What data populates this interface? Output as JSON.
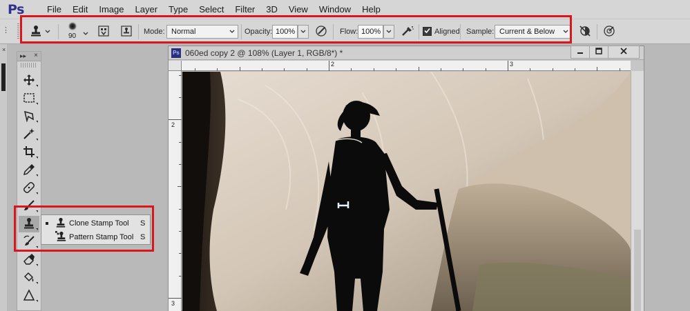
{
  "app": {
    "logo": "Ps",
    "brand_color": "#31318f",
    "highlight_color": "#d9161c"
  },
  "menu": [
    "File",
    "Edit",
    "Image",
    "Layer",
    "Type",
    "Select",
    "Filter",
    "3D",
    "View",
    "Window",
    "Help"
  ],
  "options_bar": {
    "brush_size": "90",
    "mode_label": "Mode:",
    "mode_value": "Normal",
    "opacity_label": "Opacity:",
    "opacity_value": "100%",
    "flow_label": "Flow:",
    "flow_value": "100%",
    "aligned_label": "Aligned",
    "aligned_checked": true,
    "sample_label": "Sample:",
    "sample_value": "Current & Below"
  },
  "tools": [
    {
      "name": "move-tool-icon"
    },
    {
      "name": "marquee-tool-icon"
    },
    {
      "name": "lasso-tool-icon"
    },
    {
      "name": "magic-wand-tool-icon"
    },
    {
      "name": "crop-tool-icon"
    },
    {
      "name": "eyedropper-tool-icon"
    },
    {
      "name": "healing-brush-tool-icon"
    },
    {
      "name": "brush-tool-icon"
    },
    {
      "name": "clone-stamp-tool-icon",
      "active": true
    },
    {
      "name": "history-brush-tool-icon"
    },
    {
      "name": "eraser-tool-icon"
    },
    {
      "name": "paint-bucket-tool-icon"
    },
    {
      "name": "blur-tool-icon"
    }
  ],
  "flyout": {
    "items": [
      {
        "label": "Clone Stamp Tool",
        "shortcut": "S",
        "selected": true
      },
      {
        "label": "Pattern Stamp Tool",
        "shortcut": "S",
        "selected": false
      }
    ]
  },
  "document": {
    "badge": "Ps",
    "title": "060ed copy 2 @ 108% (Layer 1, RGB/8*) *",
    "ruler_top": [
      "2",
      "3"
    ],
    "ruler_left": [
      "2",
      "3"
    ]
  }
}
